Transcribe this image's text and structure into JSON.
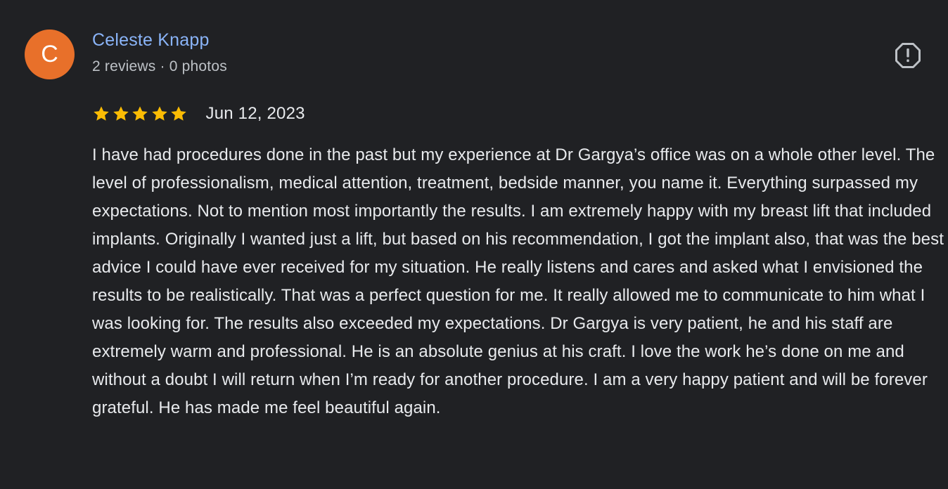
{
  "review": {
    "avatar": {
      "initial": "C",
      "color": "#e8702a"
    },
    "author": {
      "name": "Celeste Knapp",
      "meta": "2 reviews · 0 photos"
    },
    "report_icon": "report-flag-icon",
    "rating": {
      "stars": 5,
      "max": 5,
      "star_color": "#fbbc04"
    },
    "date": "Jun 12, 2023",
    "text": "I have had procedures done in the past but my experience at Dr Gargya’s office was on a whole other level. The level of professionalism, medical attention, treatment, bedside manner, you name it. Everything surpassed my expectations. Not to mention most importantly the results. I am extremely happy with my breast lift that included implants. Originally I wanted just a lift, but based on his recommendation, I got the implant also, that was the best advice I could have ever received for my situation. He really listens and cares and asked what I envisioned the results to be realistically. That was a perfect question for me. It really allowed me to communicate to him what I was looking for. The results also exceeded my expectations. Dr Gargya is very patient, he and his staff are extremely warm and professional. He is an absolute genius at his craft. I love the work he’s done on me and without a doubt I will return when I’m ready for another procedure. I am a very happy patient and will be forever grateful. He has made me feel beautiful again."
  }
}
